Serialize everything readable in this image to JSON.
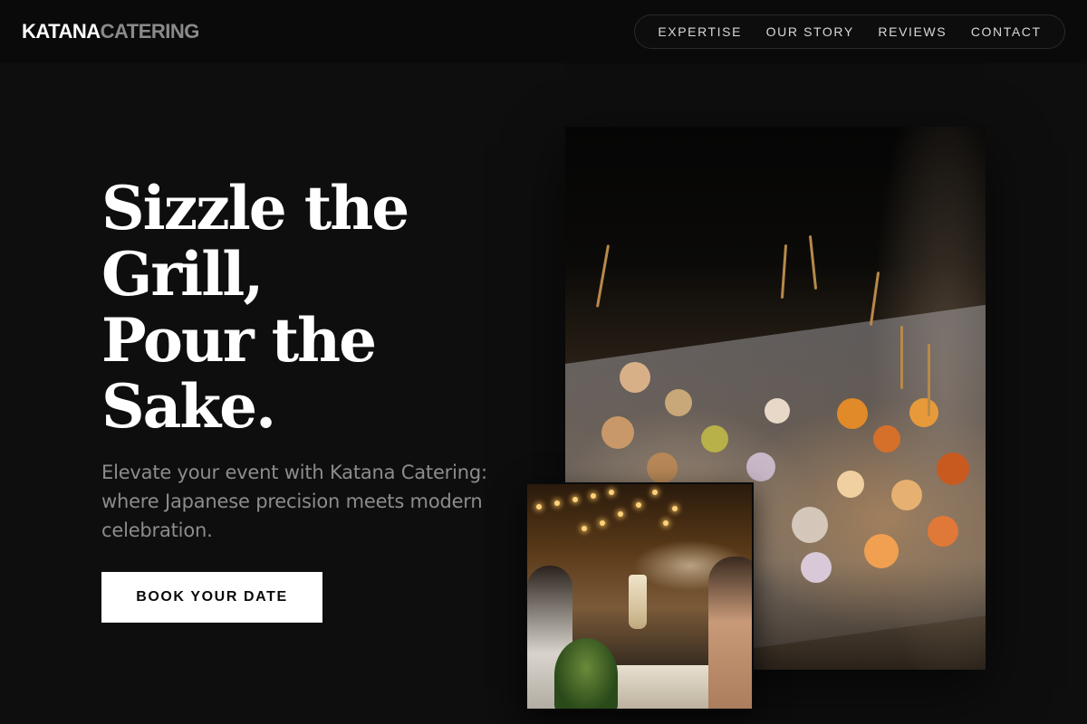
{
  "brand": {
    "name_strong": "KATANA",
    "name_dim": "CATERING"
  },
  "nav": {
    "items": [
      {
        "label": "EXPERTISE"
      },
      {
        "label": "OUR STORY"
      },
      {
        "label": "REVIEWS"
      },
      {
        "label": "CONTACT"
      }
    ]
  },
  "hero": {
    "headline_lines": [
      "Sizzle the",
      "Grill,",
      "Pour the",
      "Sake."
    ],
    "subtext": "Elevate your event with Katana Catering: where Japanese precision meets modern celebration.",
    "cta_label": "BOOK YOUR DATE"
  },
  "colors": {
    "background": "#0e0e0e",
    "header_bg": "#0a0a0a",
    "text_primary": "#ffffff",
    "text_muted": "#8c8c8c",
    "cta_bg": "#ffffff",
    "cta_text": "#0a0a0a"
  }
}
